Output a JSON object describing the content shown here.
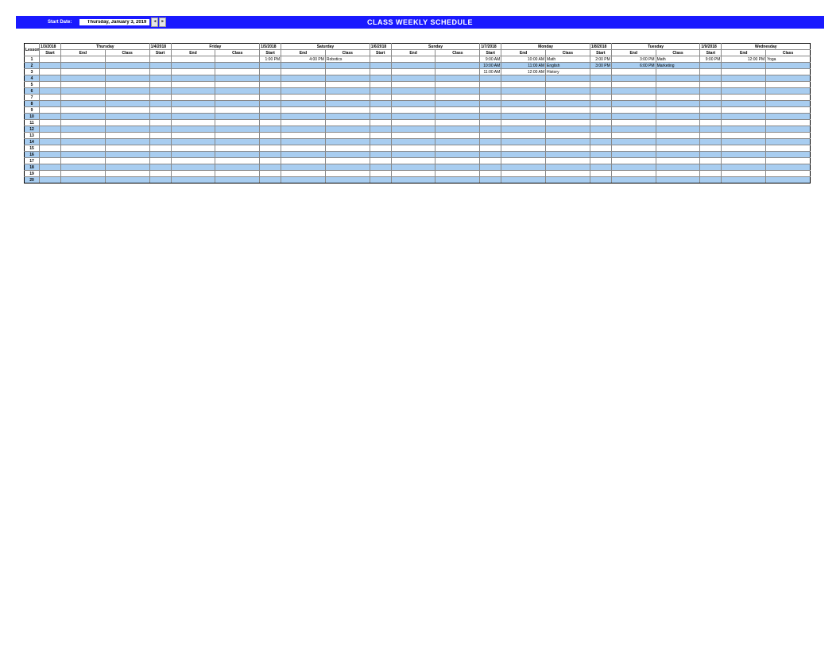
{
  "header": {
    "start_date_label": "Start Date:",
    "start_date_value": "Thursday, January 3, 2019",
    "title": "CLASS WEEKLY SCHEDULE",
    "spin_left": "◄",
    "spin_right": "►"
  },
  "columns": {
    "lesson": "Lesson",
    "start": "Start",
    "end": "End",
    "class": "Class"
  },
  "days": [
    {
      "date": "1/3/2018",
      "name": "Thursday"
    },
    {
      "date": "1/4/2018",
      "name": "Friday"
    },
    {
      "date": "1/5/2018",
      "name": "Saturday"
    },
    {
      "date": "1/6/2018",
      "name": "Sunday"
    },
    {
      "date": "1/7/2018",
      "name": "Monday"
    },
    {
      "date": "1/8/2018",
      "name": "Tuesday"
    },
    {
      "date": "1/9/2018",
      "name": "Wednesday"
    }
  ],
  "rows": [
    {
      "n": "1",
      "cells": [
        {
          "s": "",
          "e": "",
          "c": ""
        },
        {
          "s": "",
          "e": "",
          "c": ""
        },
        {
          "s": "1:00 PM",
          "e": "4:00 PM",
          "c": "Robotics"
        },
        {
          "s": "",
          "e": "",
          "c": ""
        },
        {
          "s": "9:00 AM",
          "e": "10:00 AM",
          "c": "Math"
        },
        {
          "s": "2:00 PM",
          "e": "3:00 PM",
          "c": "Math"
        },
        {
          "s": "9:00 PM",
          "e": "12:00 PM",
          "c": "Yoga"
        }
      ]
    },
    {
      "n": "2",
      "cells": [
        {
          "s": "",
          "e": "",
          "c": ""
        },
        {
          "s": "",
          "e": "",
          "c": ""
        },
        {
          "s": "",
          "e": "",
          "c": ""
        },
        {
          "s": "",
          "e": "",
          "c": ""
        },
        {
          "s": "10:00 AM",
          "e": "11:00 AM",
          "c": "English"
        },
        {
          "s": "3:00 PM",
          "e": "6:00 PM",
          "c": "Marketing"
        },
        {
          "s": "",
          "e": "",
          "c": ""
        }
      ]
    },
    {
      "n": "3",
      "cells": [
        {
          "s": "",
          "e": "",
          "c": ""
        },
        {
          "s": "",
          "e": "",
          "c": ""
        },
        {
          "s": "",
          "e": "",
          "c": ""
        },
        {
          "s": "",
          "e": "",
          "c": ""
        },
        {
          "s": "11:00 AM",
          "e": "12:00 AM",
          "c": "History"
        },
        {
          "s": "",
          "e": "",
          "c": ""
        },
        {
          "s": "",
          "e": "",
          "c": ""
        }
      ]
    },
    {
      "n": "4"
    },
    {
      "n": "5"
    },
    {
      "n": "6"
    },
    {
      "n": "7"
    },
    {
      "n": "8"
    },
    {
      "n": "9"
    },
    {
      "n": "10"
    },
    {
      "n": "11"
    },
    {
      "n": "12"
    },
    {
      "n": "13"
    },
    {
      "n": "14"
    },
    {
      "n": "15"
    },
    {
      "n": "16"
    },
    {
      "n": "17"
    },
    {
      "n": "18"
    },
    {
      "n": "19"
    },
    {
      "n": "20"
    }
  ]
}
